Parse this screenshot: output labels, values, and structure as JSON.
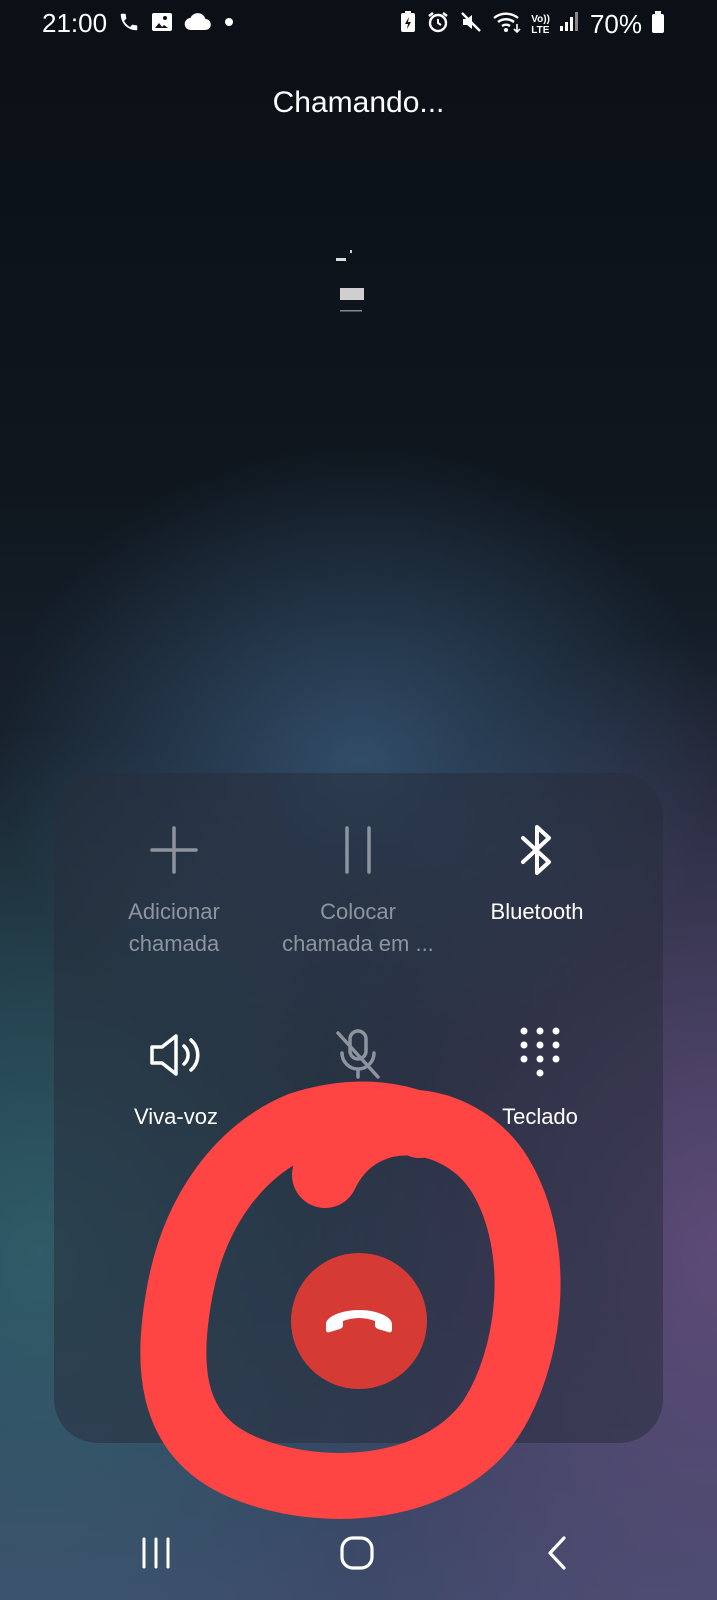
{
  "status_bar": {
    "time": "21:00",
    "left_icons": [
      "phone-icon",
      "gallery-icon",
      "cloud-icon",
      "dot-icon"
    ],
    "right_icons": [
      "battery-saver-icon",
      "alarm-icon",
      "mute-icon",
      "wifi-icon",
      "volte-icon",
      "signal-icon",
      "battery-icon"
    ],
    "volte_label_top": "Vo))",
    "volte_label_bottom": "LTE",
    "battery_percent": "70%"
  },
  "call": {
    "status": "Chamando..."
  },
  "controls": {
    "add_call": {
      "line1": "Adicionar",
      "line2": "chamada",
      "icon": "plus-icon",
      "enabled": false
    },
    "hold": {
      "line1": "Colocar",
      "line2": "chamada em ...",
      "icon": "pause-icon",
      "enabled": false
    },
    "bluetooth": {
      "line1": "Bluetooth",
      "line2": "",
      "icon": "bluetooth-icon",
      "enabled": true
    },
    "speaker": {
      "line1": "Viva-voz",
      "icon": "speaker-icon",
      "enabled": true
    },
    "mute": {
      "line1": "",
      "icon": "mic-off-icon",
      "enabled": false
    },
    "keypad": {
      "line1": "Teclado",
      "icon": "keypad-icon",
      "enabled": true
    }
  },
  "end_call": {
    "icon": "end-call-icon",
    "color": "#d63a35"
  },
  "annotation": {
    "color": "#ff4444",
    "shape": "hand-drawn circle around end call button"
  },
  "nav_bar": {
    "icons": [
      "recents-icon",
      "home-icon",
      "back-icon"
    ]
  }
}
